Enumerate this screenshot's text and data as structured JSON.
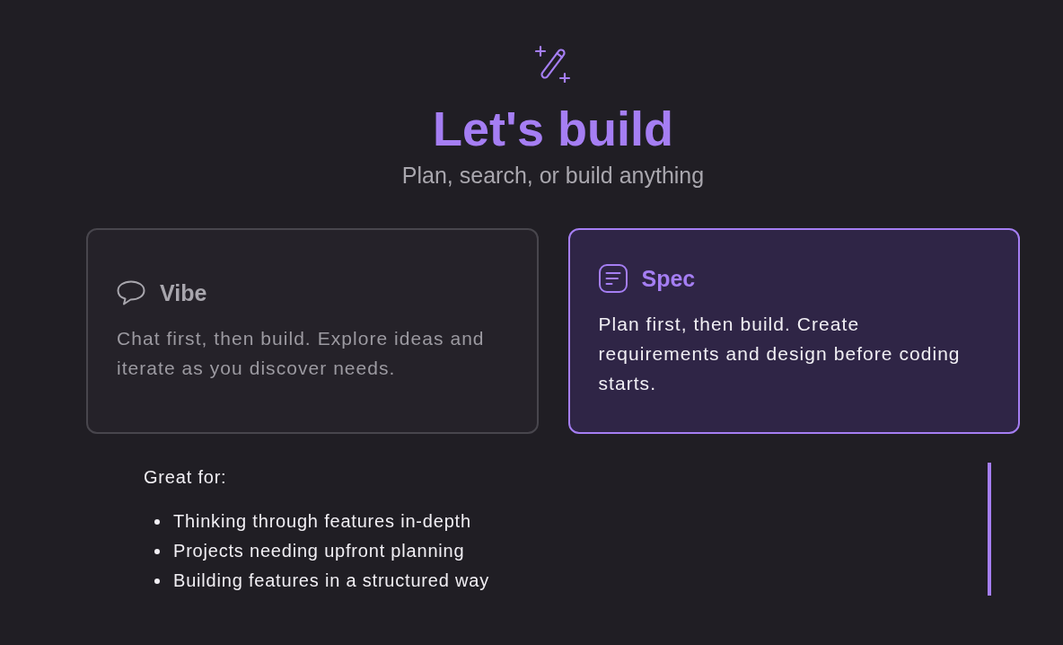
{
  "header": {
    "title": "Let's build",
    "subtitle": "Plan, search, or build anything"
  },
  "modes": [
    {
      "kind": "chat",
      "title": "Vibe",
      "description": "Chat first, then build. Explore ideas and iterate as you discover needs.",
      "selected": false
    },
    {
      "kind": "spec",
      "title": "Spec",
      "description": "Plan first, then build. Create requirements and design before coding starts.",
      "selected": true
    }
  ],
  "great_for": {
    "label": "Great for:",
    "items": [
      "Thinking through features in-depth",
      "Projects needing upfront planning",
      "Building features in a structured way"
    ]
  }
}
